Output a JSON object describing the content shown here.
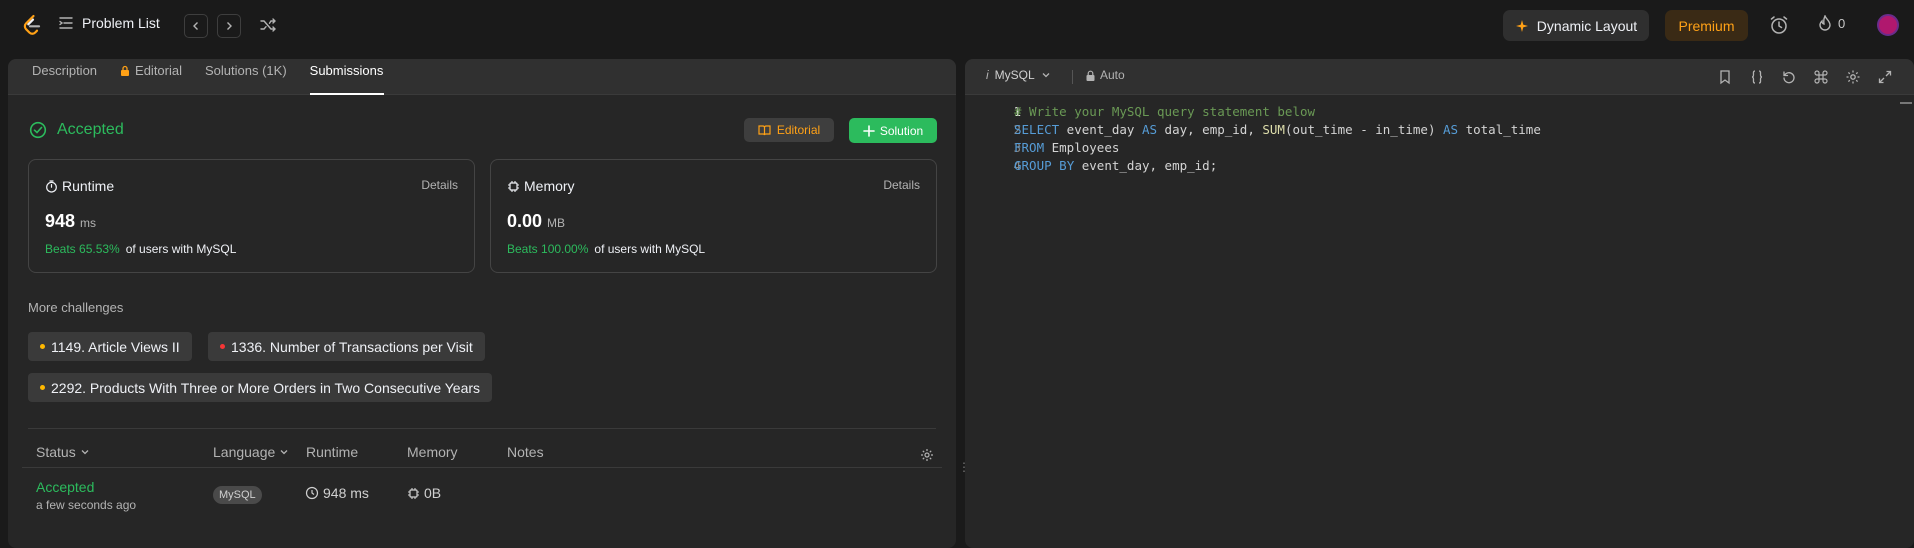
{
  "topbar": {
    "problem_list": "Problem List",
    "dynamic_layout": "Dynamic Layout",
    "premium": "Premium",
    "streak_count": "0"
  },
  "tabs": [
    {
      "label": "Description"
    },
    {
      "label": "Editorial"
    },
    {
      "label": "Solutions (1K)"
    },
    {
      "label": "Submissions"
    }
  ],
  "result": {
    "status": "Accepted",
    "editorial_button": "Editorial",
    "solution_button": "Solution",
    "runtime": {
      "title": "Runtime",
      "details": "Details",
      "value": "948",
      "unit": "ms",
      "beats": "Beats 65.53%",
      "beats_suffix": "of users with MySQL"
    },
    "memory": {
      "title": "Memory",
      "details": "Details",
      "value": "0.00",
      "unit": "MB",
      "beats": "Beats 100.00%",
      "beats_suffix": "of users with MySQL"
    }
  },
  "more_challenges": {
    "label": "More challenges",
    "items": [
      {
        "label": "1149. Article Views II",
        "difficulty_color": "#ffb800"
      },
      {
        "label": "1336. Number of Transactions per Visit",
        "difficulty_color": "#f63636"
      },
      {
        "label": "2292. Products With Three or More Orders in Two Consecutive Years",
        "difficulty_color": "#ffb800"
      }
    ]
  },
  "submissions_table": {
    "headers": {
      "status": "Status",
      "language": "Language",
      "runtime": "Runtime",
      "memory": "Memory",
      "notes": "Notes"
    },
    "rows": [
      {
        "status": "Accepted",
        "time": "a few seconds ago",
        "language": "MySQL",
        "runtime": "948 ms",
        "memory": "0B"
      }
    ]
  },
  "editor": {
    "language": "MySQL",
    "auto": "Auto",
    "lines": [
      {
        "n": "1",
        "text": "# Write your MySQL query statement below"
      },
      {
        "n": "2",
        "text": "SELECT event_day AS day, emp_id, SUM(out_time - in_time) AS total_time"
      },
      {
        "n": "3",
        "text": "FROM Employees"
      },
      {
        "n": "4",
        "text": "GROUP BY event_day, emp_id;"
      }
    ]
  },
  "colors": {
    "accent_green": "#2cbb5d",
    "accent_orange": "#ffa116"
  }
}
